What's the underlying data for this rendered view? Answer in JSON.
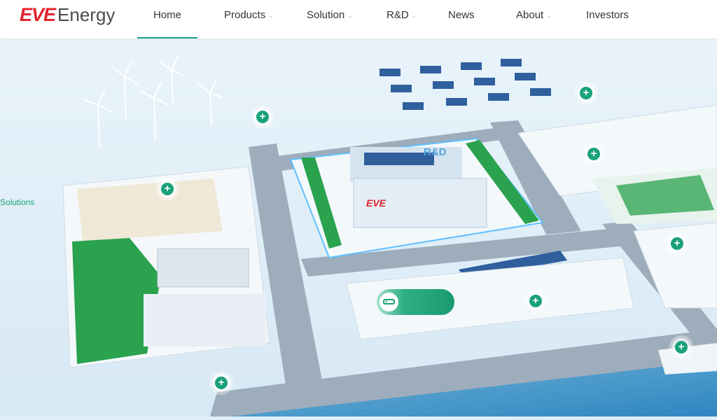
{
  "brand": {
    "mark": "EVE",
    "word": "Energy"
  },
  "nav": {
    "home": "Home",
    "products": "Products",
    "solution": "Solution",
    "rd": "R&D",
    "news": "News",
    "about": "About",
    "investors": "Investors"
  },
  "scene": {
    "side_label": "Solutions",
    "building_label": "R&D",
    "building_logo": "EVE"
  },
  "colors": {
    "accent": "#1aa27b",
    "brand_red": "#e3232c"
  },
  "icons": {
    "hotspot": "plus-icon",
    "caret": "chevron-down-icon",
    "vehicle": "bus-icon"
  }
}
